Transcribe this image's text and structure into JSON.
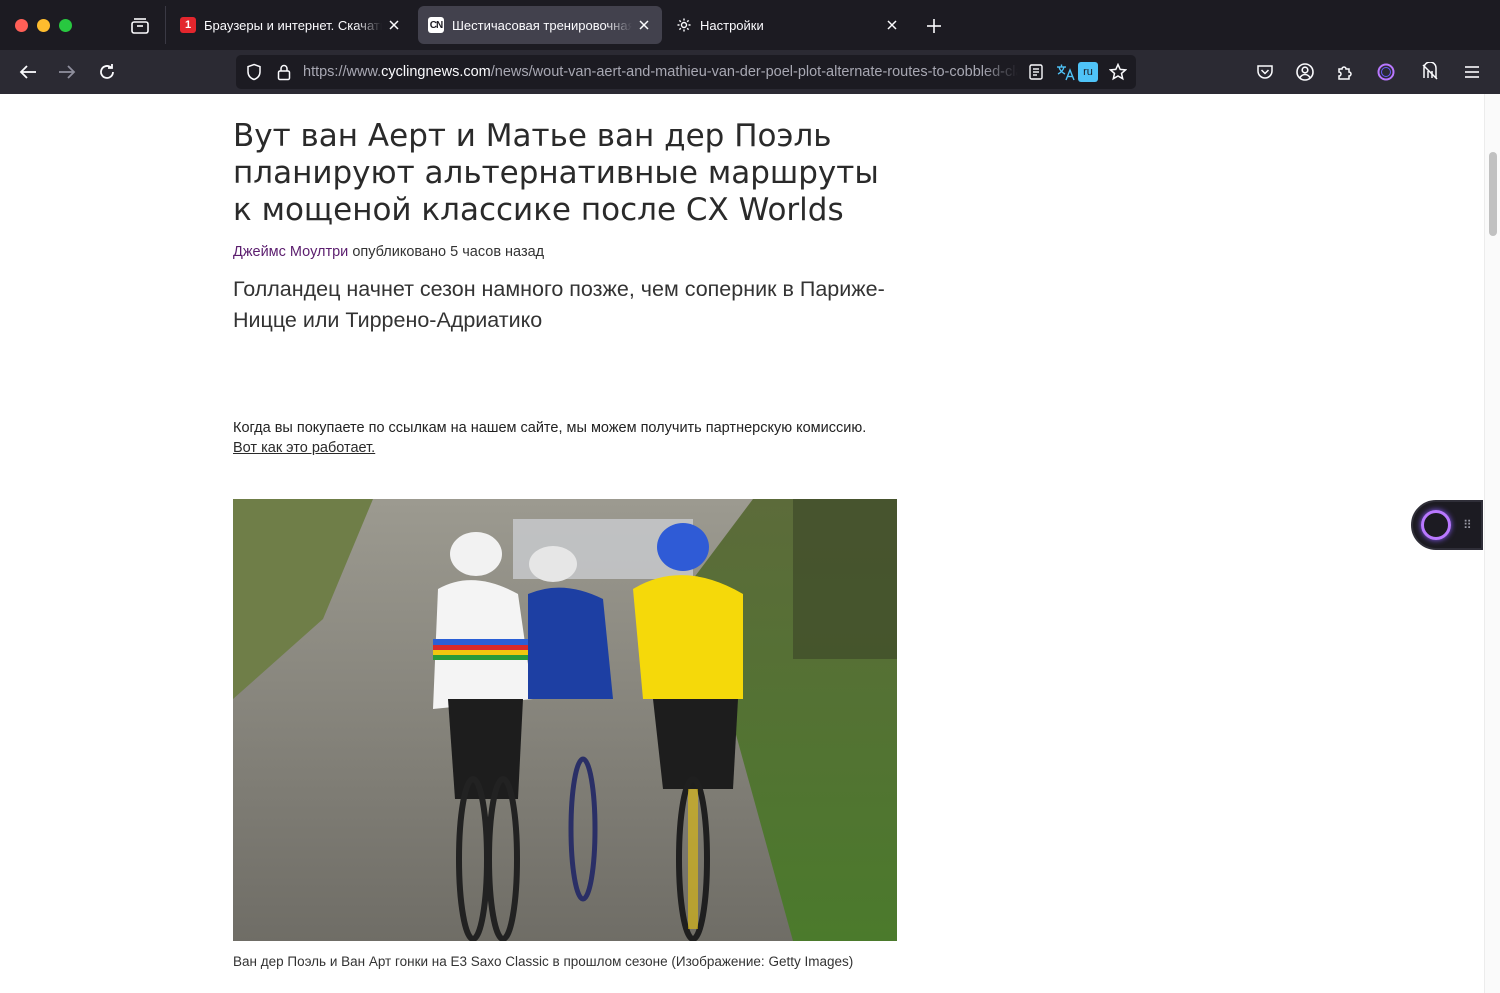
{
  "browser": {
    "tabs": [
      {
        "title": "Браузеры и интернет. Скачать",
        "favicon": "1",
        "active": false
      },
      {
        "title": "Шестичасовая тренировочная",
        "favicon": "CN",
        "active": true
      },
      {
        "title": "Настройки",
        "favicon": "gear-icon",
        "active": false
      }
    ],
    "url": {
      "scheme": "https://www.",
      "host": "cyclingnews.com",
      "path": "/news/wout-van-aert-and-mathieu-van-der-poel-plot-alternate-routes-to-cobbled-classics-after-cx-worlds/"
    },
    "translate_badge": "ru",
    "colors": {
      "chrome_dark": "#1c1b22",
      "toolbar": "#2b2a33",
      "active_tab": "#42414d",
      "accent_purple": "#b978ff"
    }
  },
  "article": {
    "headline": "Вут ван Аерт и Матье ван дер Поэль планируют альтернативные маршруты к мощеной классике после CX Worlds",
    "author": "Джеймс Моултри",
    "published": "опубликовано 5 часов назад",
    "standfirst": "Голландец начнет сезон намного позже, чем соперник в Париже-Ницце или Тиррено-Адриатико",
    "affiliate_text": "Когда вы покупаете по ссылкам на нашем сайте, мы можем получить партнерскую комиссию.",
    "affiliate_link": "Вот как это работает.",
    "image_caption": "Ван дер Поэль и Ван Арт гонки на E3 Saxo Classic в прошлом сезоне (Изображение: Getty Images)"
  }
}
